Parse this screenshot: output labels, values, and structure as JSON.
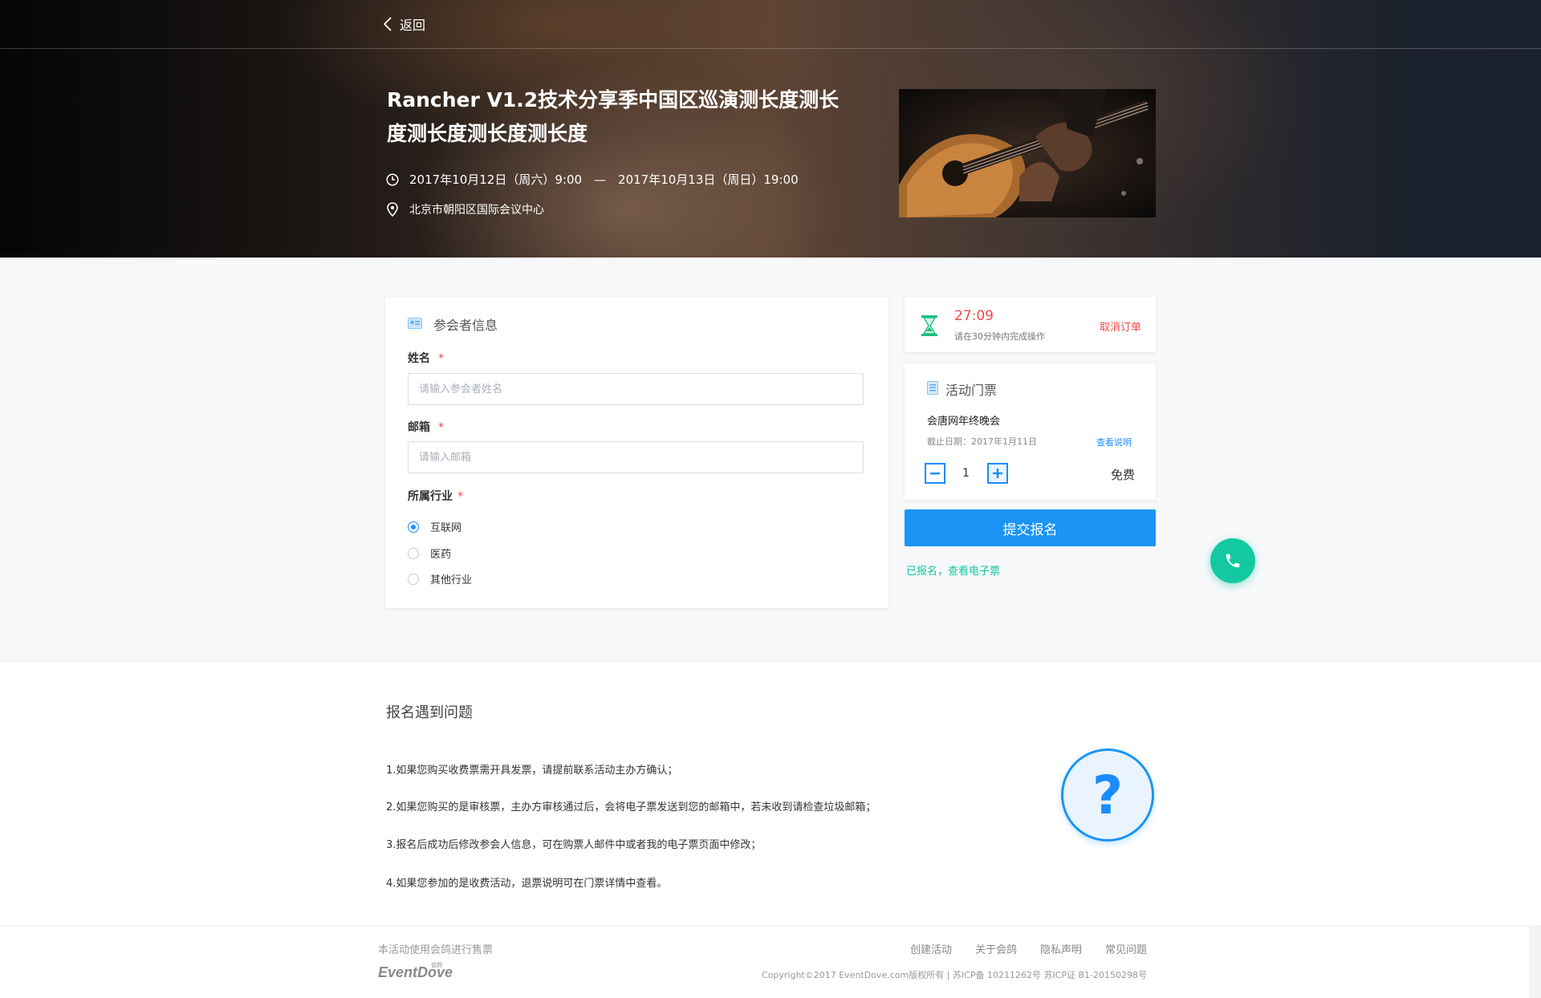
{
  "header": {
    "back_label": "返回"
  },
  "event": {
    "title": "Rancher V1.2技术分享季中国区巡演测长度测长度测长度测长度测长度",
    "time": "2017年10月12日（周六）9:00　—　2017年10月13日（周日）19:00",
    "location": "北京市朝阳区国际会议中心"
  },
  "form": {
    "section_title": "参会者信息",
    "name_label": "姓名",
    "name_placeholder": "请输入参会者姓名",
    "email_label": "邮箱",
    "email_placeholder": "请输入邮箱",
    "industry_label": "所属行业",
    "required_mark": "*",
    "industry_options": [
      "互联网",
      "医药",
      "其他行业"
    ],
    "industry_selected_index": 0
  },
  "timer": {
    "countdown": "27:09",
    "hint": "请在30分钟内完成操作",
    "cancel_label": "取消订单"
  },
  "ticket": {
    "section_title": "活动门票",
    "name": "会唐网年终晚会",
    "deadline": "截止日期：2017年1月11日",
    "detail_link": "查看说明",
    "quantity": "1",
    "price": "免费"
  },
  "actions": {
    "submit_label": "提交报名",
    "eticket_link": "已报名，查看电子票"
  },
  "faq": {
    "title": "报名遇到问题",
    "items": [
      "1.如果您购买收费票需开具发票，请提前联系活动主办方确认；",
      "2.如果您购买的是审核票，主办方审核通过后，会将电子票发送到您的邮箱中，若未收到请检查垃圾邮箱；",
      "3.报名后成功后修改参会人信息，可在购票人邮件中或者我的电子票页面中修改；",
      "4.如果您参加的是收费活动，退票说明可在门票详情中查看。"
    ],
    "icon_glyph": "?"
  },
  "footer": {
    "note": "本活动使用会鸽进行售票",
    "logo_text": "EventDove",
    "logo_cn": "会鸽",
    "links": [
      "创建活动",
      "关于会鸽",
      "隐私声明",
      "常见问题"
    ],
    "copyright": "Copyright©2017 EventDove.com版权所有  |  苏ICP备 10211262号  苏ICP证 B1-20150298号"
  },
  "colors": {
    "primary": "#1a95f5",
    "accent_green": "#13c9a1",
    "danger": "#f04848",
    "band_bg": "#f7f8fa"
  }
}
